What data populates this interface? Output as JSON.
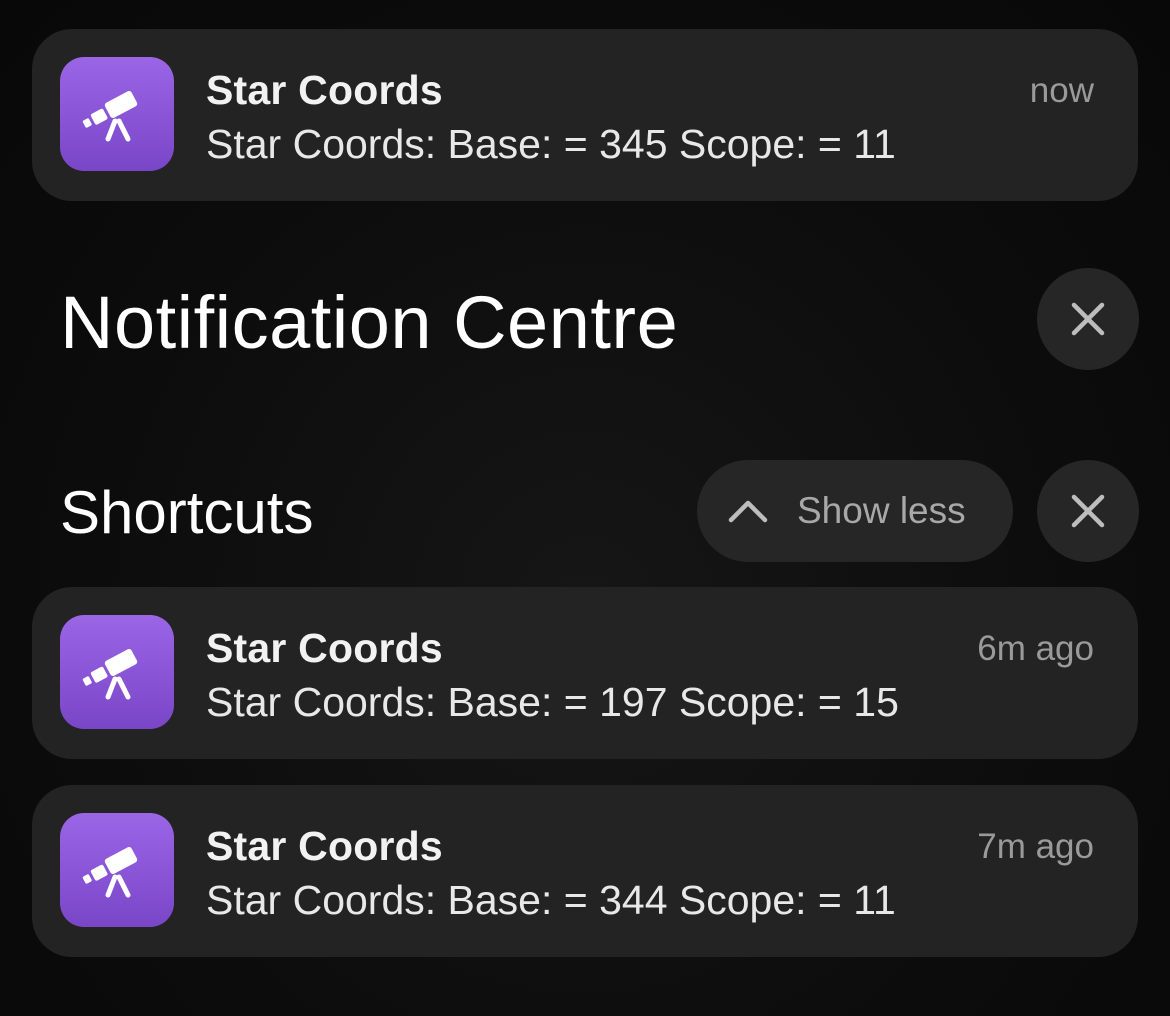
{
  "top_notification": {
    "app": "Star Coords",
    "body": "Star Coords: Base: = 345 Scope: = 11",
    "time": "now",
    "icon": "telescope-icon"
  },
  "notification_centre": {
    "title": "Notification Centre",
    "close_icon": "close-icon"
  },
  "group": {
    "title": "Shortcuts",
    "show_less_label": "Show less",
    "chevron_icon": "chevron-up-icon",
    "close_icon": "close-icon",
    "notifications": [
      {
        "app": "Star Coords",
        "body": "Star Coords: Base: = 197 Scope: = 15",
        "time": "6m ago",
        "icon": "telescope-icon"
      },
      {
        "app": "Star Coords",
        "body": "Star Coords: Base: = 344 Scope: = 11",
        "time": "7m ago",
        "icon": "telescope-icon"
      }
    ]
  },
  "colors": {
    "background": "#0b0b0b",
    "card": "#232323",
    "button": "#262626",
    "icon_gradient_top": "#9a66e6",
    "icon_gradient_bottom": "#7a46c8",
    "secondary_text": "#9a9a9a"
  }
}
